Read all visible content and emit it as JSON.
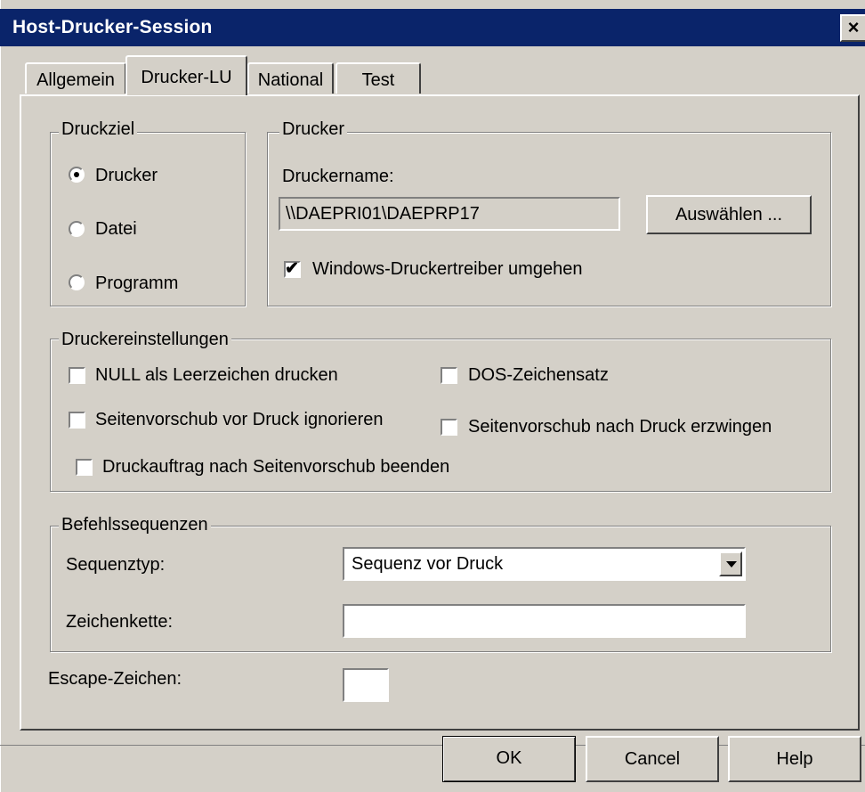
{
  "window": {
    "title": "Host-Drucker-Session",
    "close_label": "×"
  },
  "tabs": [
    {
      "label": "Allgemein",
      "active": false
    },
    {
      "label": "Drucker-LU",
      "active": true
    },
    {
      "label": "National",
      "active": false
    },
    {
      "label": "Test",
      "active": false
    }
  ],
  "druckziel": {
    "legend": "Druckziel",
    "options": [
      {
        "label": "Drucker",
        "selected": true
      },
      {
        "label": "Datei",
        "selected": false
      },
      {
        "label": "Programm",
        "selected": false
      }
    ]
  },
  "drucker": {
    "legend": "Drucker",
    "name_label": "Druckername:",
    "name_value": "\\\\DAEPRI01\\DAEPRP17",
    "select_button": "Auswählen ...",
    "bypass_driver_label": "Windows-Druckertreiber umgehen",
    "bypass_driver_checked": true
  },
  "druckereinstellungen": {
    "legend": "Druckereinstellungen",
    "null_as_space": {
      "label": "NULL als Leerzeichen drucken",
      "checked": false
    },
    "dos_charset": {
      "label": "DOS-Zeichensatz",
      "checked": false
    },
    "ignore_formfeed_before": {
      "label": "Seitenvorschub vor Druck ignorieren",
      "checked": false
    },
    "force_formfeed_after": {
      "label": "Seitenvorschub nach Druck erzwingen",
      "checked": false
    },
    "end_job_after_formfeed": {
      "label": "Druckauftrag nach Seitenvorschub beenden",
      "checked": false
    }
  },
  "befehlssequenzen": {
    "legend": "Befehlssequenzen",
    "sequence_type_label": "Sequenztyp:",
    "sequence_type_value": "Sequenz vor Druck",
    "string_label": "Zeichenkette:",
    "string_value": ""
  },
  "escape": {
    "label": "Escape-Zeichen:",
    "value": ""
  },
  "buttons": {
    "ok": "OK",
    "cancel": "Cancel",
    "help": "Help"
  }
}
